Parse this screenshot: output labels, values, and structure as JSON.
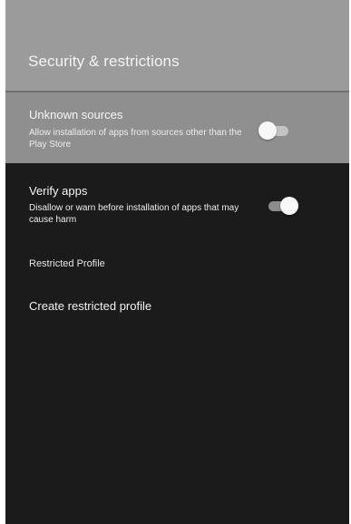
{
  "header": {
    "title": "Security & restrictions"
  },
  "settings": {
    "unknown_sources": {
      "title": "Unknown sources",
      "description": "Allow installation of apps from sources other than the Play Store",
      "enabled": false
    },
    "verify_apps": {
      "title": "Verify apps",
      "description": "Disallow or warn before installation of apps that may cause harm",
      "enabled": true
    }
  },
  "restricted_profile": {
    "section_label": "Restricted Profile",
    "create_label": "Create restricted profile"
  },
  "colors": {
    "header_background": "#9b9b9b",
    "selected_row_background": "#8f8f8f",
    "panel_background": "#1b1b1b",
    "toggle_thumb": "#f7f7f7"
  }
}
